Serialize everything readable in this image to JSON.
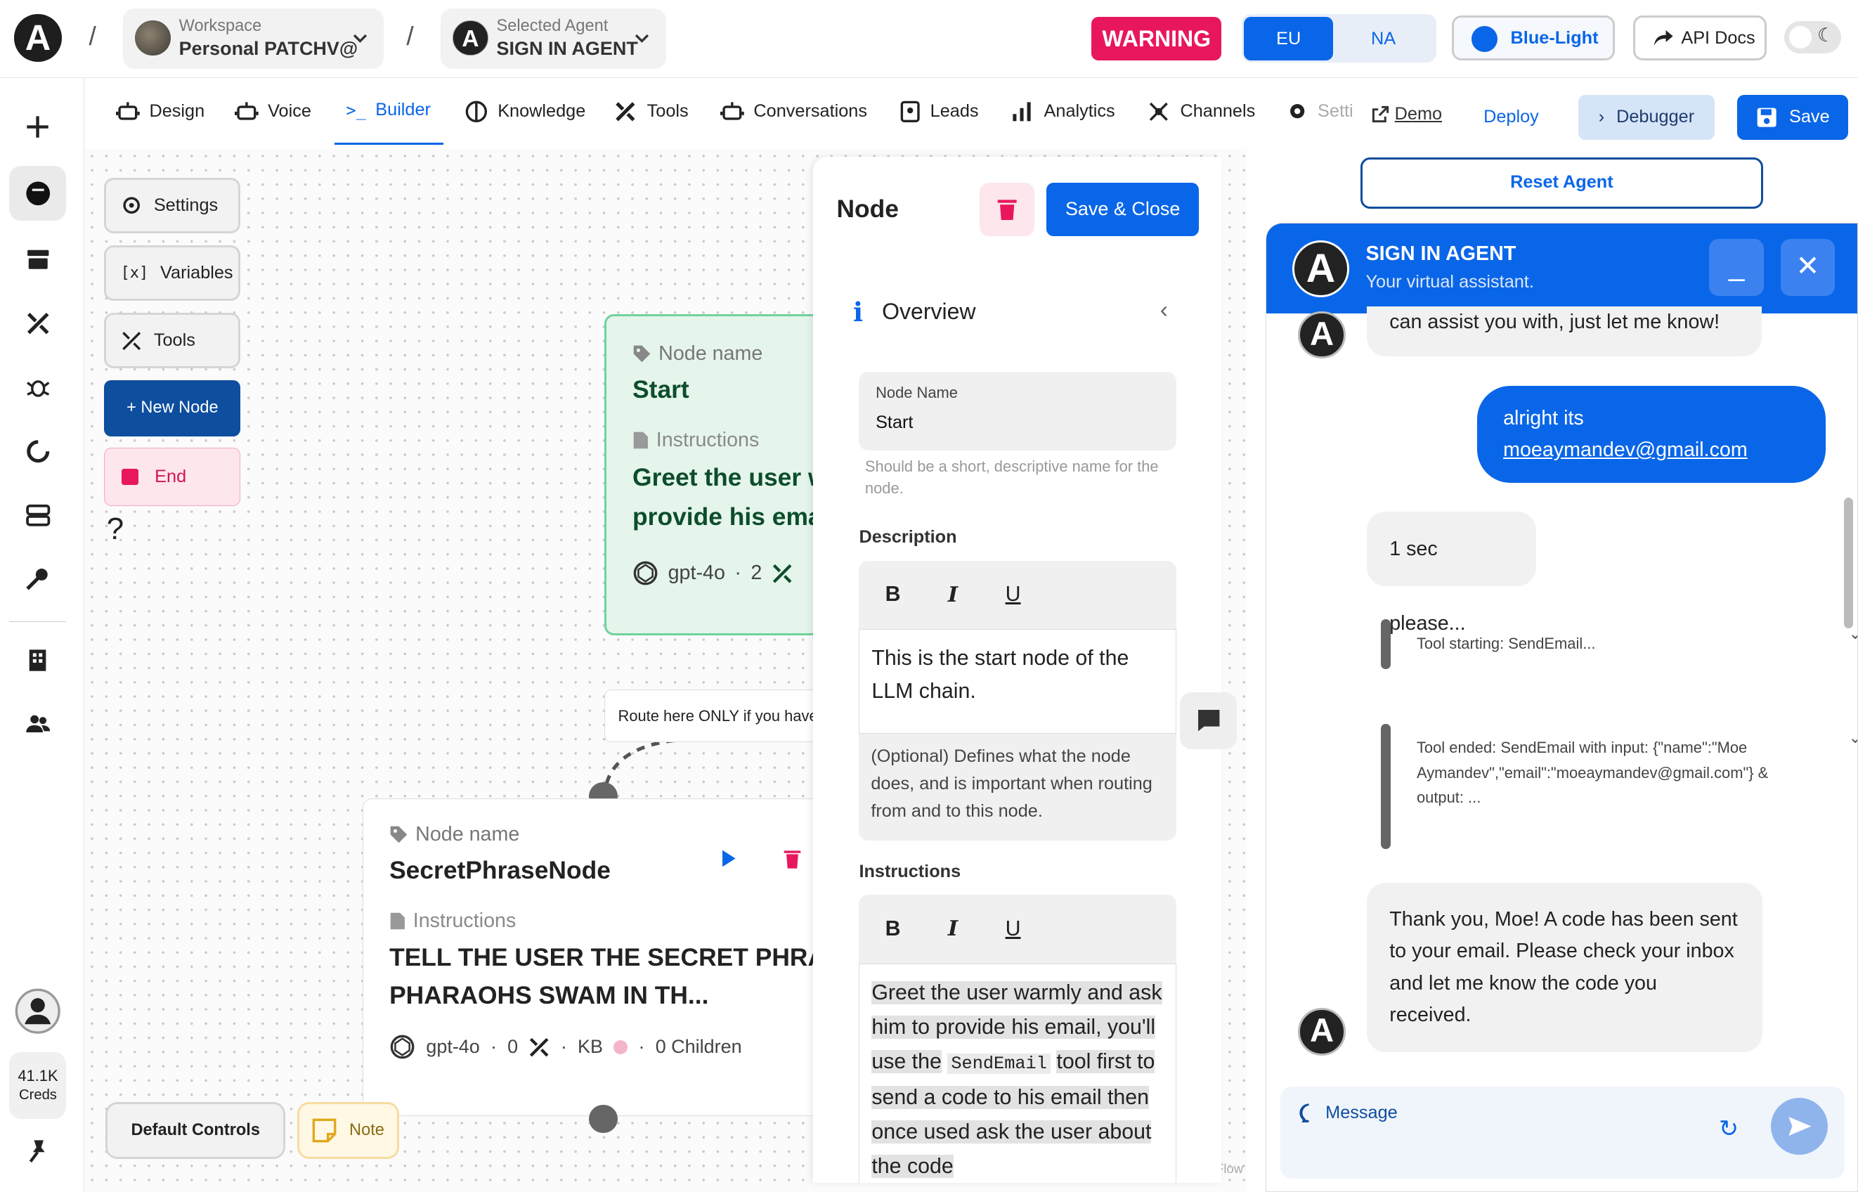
{
  "header": {
    "logo": "A",
    "workspace_label": "Workspace",
    "workspace_value": "Personal PATCHV@",
    "agent_label": "Selected Agent",
    "agent_value": "SIGN IN AGENT",
    "agent_avatar": "A",
    "warning": "WARNING",
    "regions": [
      "EU",
      "NA"
    ],
    "theme": "Blue-Light",
    "api_docs": "API Docs"
  },
  "tabs": [
    "Design",
    "Voice",
    "Builder",
    "Knowledge",
    "Tools",
    "Conversations",
    "Leads",
    "Analytics",
    "Channels",
    "Setti"
  ],
  "actions": {
    "demo": "Demo",
    "deploy": "Deploy",
    "debugger": "Debugger",
    "save": "Save"
  },
  "rail": {
    "creds_value": "41.1K",
    "creds_label": "Creds"
  },
  "canvas": {
    "settings": "Settings",
    "variables": "Variables",
    "tools": "Tools",
    "new_node": "+ New Node",
    "end": "End",
    "help": "?",
    "default_controls": "Default Controls",
    "note": "Note",
    "flow_label": "Flow",
    "route_label": "Route here ONLY if you have",
    "start_node": {
      "name_label": "Node name",
      "name": "Start",
      "instr_label": "Instructions",
      "instructions": "Greet the user warmly and ask him to provide his email",
      "model": "gpt-4o",
      "sep": "·",
      "tools_count": "2"
    },
    "secret_node": {
      "name_label": "Node name",
      "name": "SecretPhraseNode",
      "instr_label": "Instructions",
      "instructions": "TELL THE USER THE SECRET PHRASE: PHARAOHS SWAM IN TH...",
      "model": "gpt-4o",
      "sep": "·",
      "tools_count": "0",
      "kb": "KB",
      "children": "0 Children"
    }
  },
  "panel": {
    "title": "Node",
    "save_close": "Save & Close",
    "overview": "Overview",
    "node_name_label": "Node Name",
    "node_name_value": "Start",
    "node_name_hint": "Should be a short, descriptive name for the node.",
    "description_label": "Description",
    "description_text": "This is the start node of the LLM chain.",
    "description_hint": "(Optional) Defines what the node does, and is important when routing from and to this node.",
    "instructions_label": "Instructions",
    "instr_part1": "Greet the user warmly and ask him to provide his email, you'll use the",
    "instr_code": "SendEmail",
    "instr_part2": "tool first to send a code to his email then once used ask the user about the code"
  },
  "chat": {
    "reset": "Reset Agent",
    "agent_name": "SIGN IN AGENT",
    "agent_sub": "Your virtual assistant.",
    "avatar": "A",
    "minimize": "_",
    "close": "✕",
    "msg1": "can assist you with, just let me know!",
    "user_msg_prefix": "alright its",
    "user_email": "moeaymandev@gmail.com",
    "msg2": "1 sec please...",
    "tool_start": "Tool starting: SendEmail...",
    "tool_end": "Tool ended: SendEmail with input: {\"name\":\"Moe Aymandev\",\"email\":\"moeaymandev@gmail.com\"} & output: ...",
    "msg3": "Thank you, Moe! A code has been sent to your email. Please check your inbox and let me know the code you received.",
    "input_placeholder": "Message"
  },
  "colors": {
    "accent": "#0a66e8",
    "warning": "#e8175d",
    "start_node_bg": "#e5f5ec",
    "start_node_border": "#6fd39b"
  }
}
